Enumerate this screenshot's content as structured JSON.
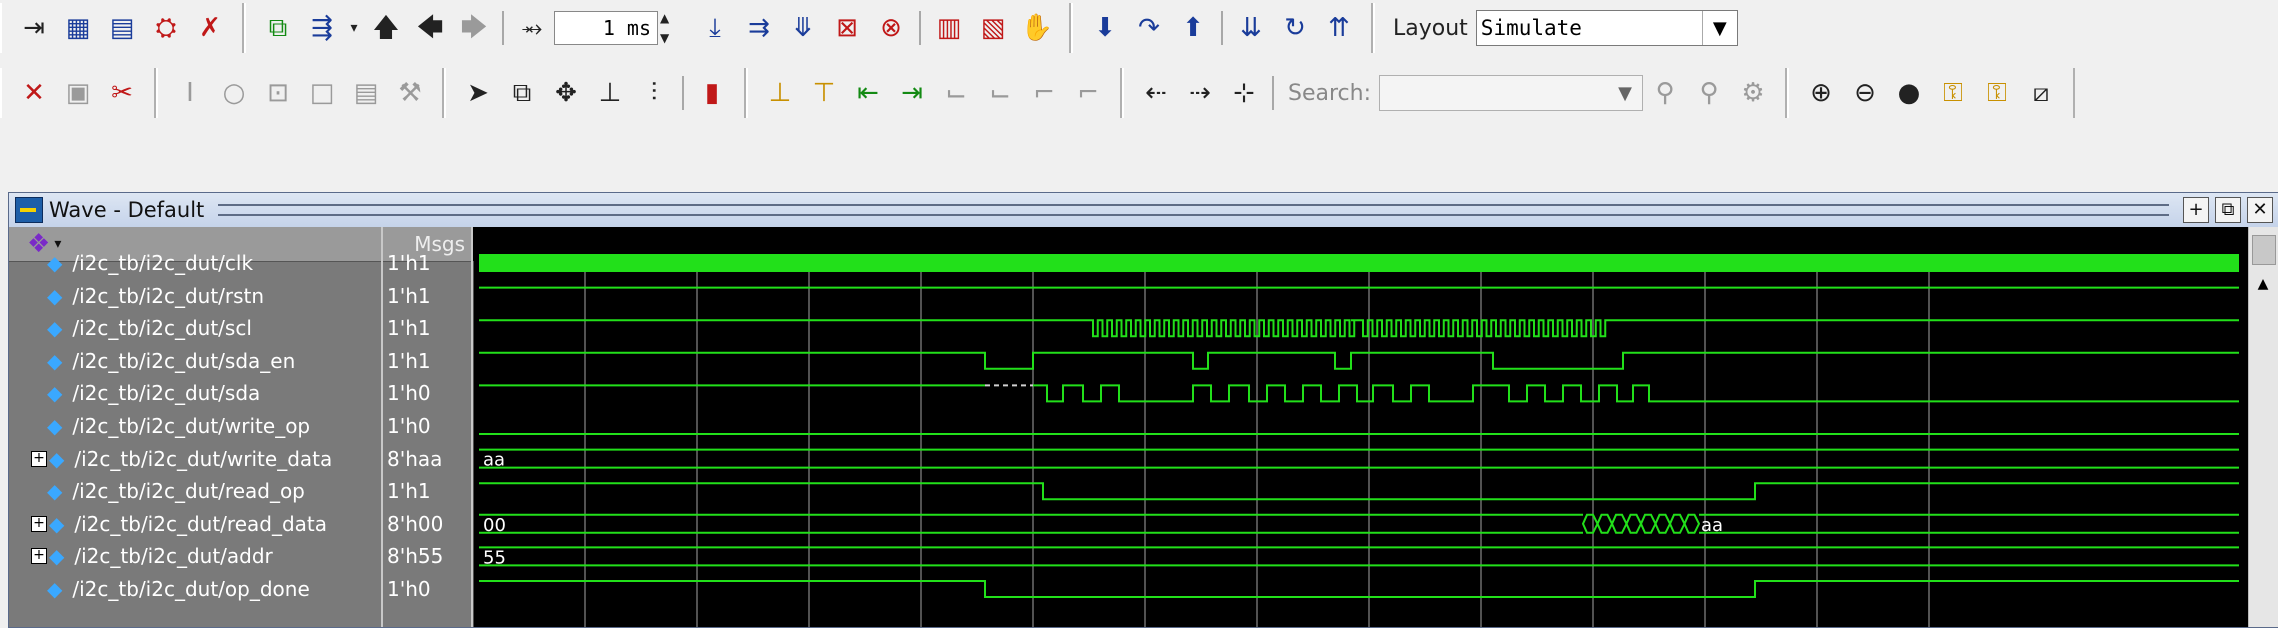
{
  "toolbar1": {
    "icons": [
      "break-icon",
      "list-icon",
      "table-icon",
      "dataflow-icon",
      "delete-icon",
      "copy-icon",
      "format-icon",
      "up-icon",
      "back-icon",
      "forward-icon",
      "run-length-icon"
    ],
    "run_length_value": "1 ms",
    "layout_label": "Layout",
    "layout_value": "Simulate"
  },
  "toolbar2": {
    "search_label": "Search:",
    "search_value": ""
  },
  "wave_window": {
    "title": "Wave - Default",
    "msgs_header": "Msgs",
    "signals": [
      {
        "name": "/i2c_tb/i2c_dut/clk",
        "value": "1'h1",
        "expandable": false
      },
      {
        "name": "/i2c_tb/i2c_dut/rstn",
        "value": "1'h1",
        "expandable": false
      },
      {
        "name": "/i2c_tb/i2c_dut/scl",
        "value": "1'h1",
        "expandable": false
      },
      {
        "name": "/i2c_tb/i2c_dut/sda_en",
        "value": "1'h1",
        "expandable": false
      },
      {
        "name": "/i2c_tb/i2c_dut/sda",
        "value": "1'h0",
        "expandable": false
      },
      {
        "name": "/i2c_tb/i2c_dut/write_op",
        "value": "1'h0",
        "expandable": false
      },
      {
        "name": "/i2c_tb/i2c_dut/write_data",
        "value": "8'haa",
        "expandable": true
      },
      {
        "name": "/i2c_tb/i2c_dut/read_op",
        "value": "1'h1",
        "expandable": false
      },
      {
        "name": "/i2c_tb/i2c_dut/read_data",
        "value": "8'h00",
        "expandable": true
      },
      {
        "name": "/i2c_tb/i2c_dut/addr",
        "value": "8'h55",
        "expandable": true
      },
      {
        "name": "/i2c_tb/i2c_dut/op_done",
        "value": "1'h0",
        "expandable": false
      }
    ],
    "bus_labels": {
      "write_data": "aa",
      "read_data_start": "00",
      "read_data_end": "aa",
      "addr": "55"
    }
  },
  "colors": {
    "wave": "#22e01a",
    "grid": "#6e6e6e",
    "plot_bg": "#000000",
    "panel_bg": "#7a7a7a"
  }
}
